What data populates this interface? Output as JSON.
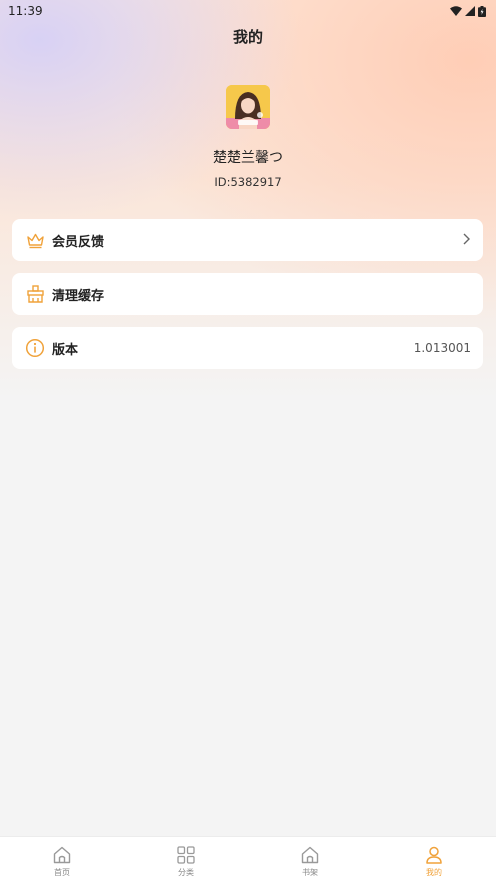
{
  "status_bar": {
    "time": "11:39"
  },
  "header": {
    "title": "我的"
  },
  "profile": {
    "name": "楚楚兰馨つ",
    "id_text": "ID:5382917"
  },
  "menu": {
    "feedback": {
      "label": "会员反馈",
      "icon": "crown-icon"
    },
    "clear_cache": {
      "label": "清理缓存",
      "icon": "broom-icon"
    },
    "version": {
      "label": "版本",
      "value": "1.013001",
      "icon": "info-icon"
    }
  },
  "tabs": [
    {
      "label": "首页",
      "icon": "home-icon",
      "active": false
    },
    {
      "label": "分类",
      "icon": "grid-icon",
      "active": false
    },
    {
      "label": "书架",
      "icon": "bookshelf-icon",
      "active": false
    },
    {
      "label": "我的",
      "icon": "user-icon",
      "active": true
    }
  ],
  "colors": {
    "accent": "#f0a23a",
    "inactive": "#999999",
    "background": "#f4f4f4"
  }
}
